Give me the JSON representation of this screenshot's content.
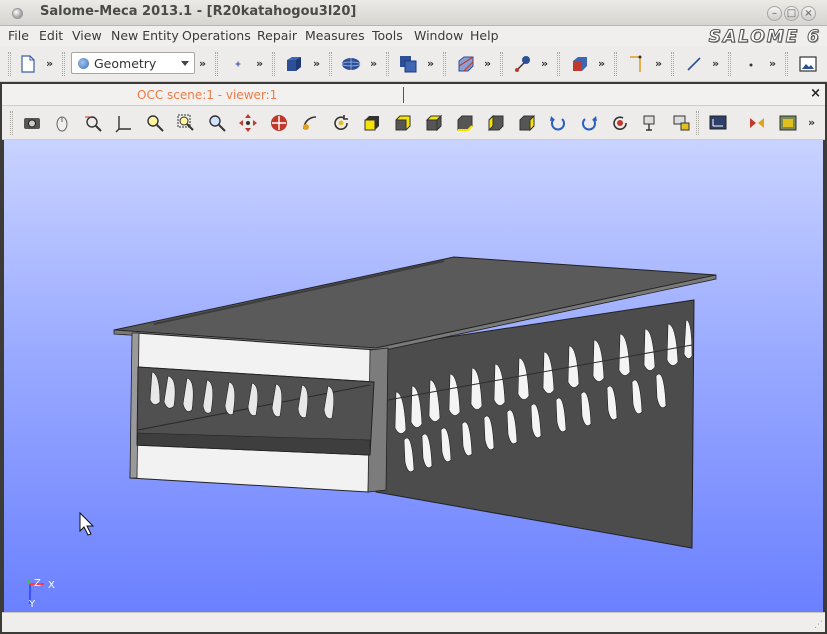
{
  "window": {
    "title": "Salome-Meca 2013.1 - [R20katahogou3l20]",
    "logo": "SALOME 6",
    "buttons": {
      "minimize": "–",
      "maximize": "□",
      "close": "×"
    }
  },
  "menu": {
    "items": [
      "File",
      "Edit",
      "View",
      "New Entity",
      "Operations",
      "Repair",
      "Measures",
      "Tools",
      "Window",
      "Help"
    ]
  },
  "toolbar": {
    "module_selector": {
      "value": "Geometry",
      "icon": "geometry-module-icon"
    },
    "extension_glyph": "»",
    "icons": [
      "new-document-icon",
      "point-icon",
      "box-icon",
      "sphere-icon",
      "boolean-icon",
      "partition-icon",
      "connection-icon",
      "group-icon",
      "line-icon",
      "vertex-icon",
      "picture-icon"
    ]
  },
  "viewer_tab": {
    "label": "OCC scene:1 - viewer:1",
    "close": "×"
  },
  "viewer_toolbar": {
    "icons": [
      "dump-view-icon",
      "mouse-icon",
      "pan-select-icon",
      "trihedron-icon",
      "fit-all-icon",
      "fit-area-icon",
      "zoom-icon",
      "pan-icon",
      "global-pan-icon",
      "rotation-point-icon",
      "rotate-icon",
      "front-view-icon",
      "back-view-icon",
      "top-view-icon",
      "bottom-view-icon",
      "left-view-icon",
      "right-view-icon",
      "anticlockwise-icon",
      "clockwise-icon",
      "reset-view-icon",
      "clone-view-icon",
      "clipping-icon",
      "graduated-axes-icon",
      "camera-icon",
      "memorize-view-icon",
      "restore-view-icon"
    ]
  },
  "viewer": {
    "axis": {
      "z": "Z",
      "x": "X",
      "y": "Y"
    },
    "colors": {
      "top": "#c9d3ff",
      "bottom": "#6b80ff",
      "shape": "#555555",
      "shape_light": "#f2f2f2"
    }
  }
}
